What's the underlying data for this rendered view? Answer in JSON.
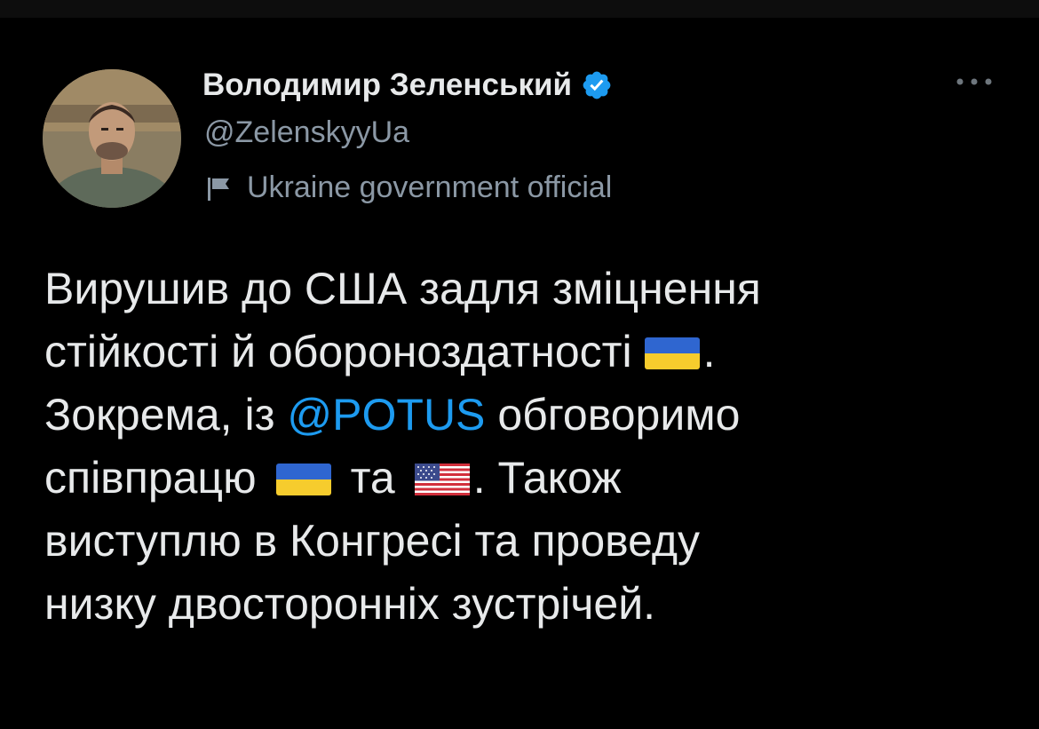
{
  "tweet": {
    "author": {
      "display_name": "Володимир Зеленський",
      "handle": "@ZelenskyyUa",
      "verified": true,
      "affiliation": "Ukraine government official",
      "avatar_icon": "profile-photo"
    },
    "more_icon": "ellipsis-icon",
    "text": {
      "line1": "Вирушив до США задля зміцнення",
      "line2_text": "стійкості й обороноздатності",
      "line2_emoji": "ukraine-flag",
      "line2_end": ".",
      "line3_start": "Зокрема, із",
      "line3_mention": "@POTUS",
      "line3_end": "обговоримо",
      "line4_start": "співпрацю",
      "line4_emoji1": "ukraine-flag",
      "line4_mid": "та",
      "line4_emoji2": "usa-flag",
      "line4_end": ". Також",
      "line5": "виступлю в Конгресі та проведу",
      "line6": "низку двосторонніх зустрічей."
    },
    "colors": {
      "background": "#000000",
      "text": "#e7e9ea",
      "secondary_text": "#8b98a5",
      "link": "#1d9bf0",
      "verified_badge": "#1d9bf0"
    }
  }
}
